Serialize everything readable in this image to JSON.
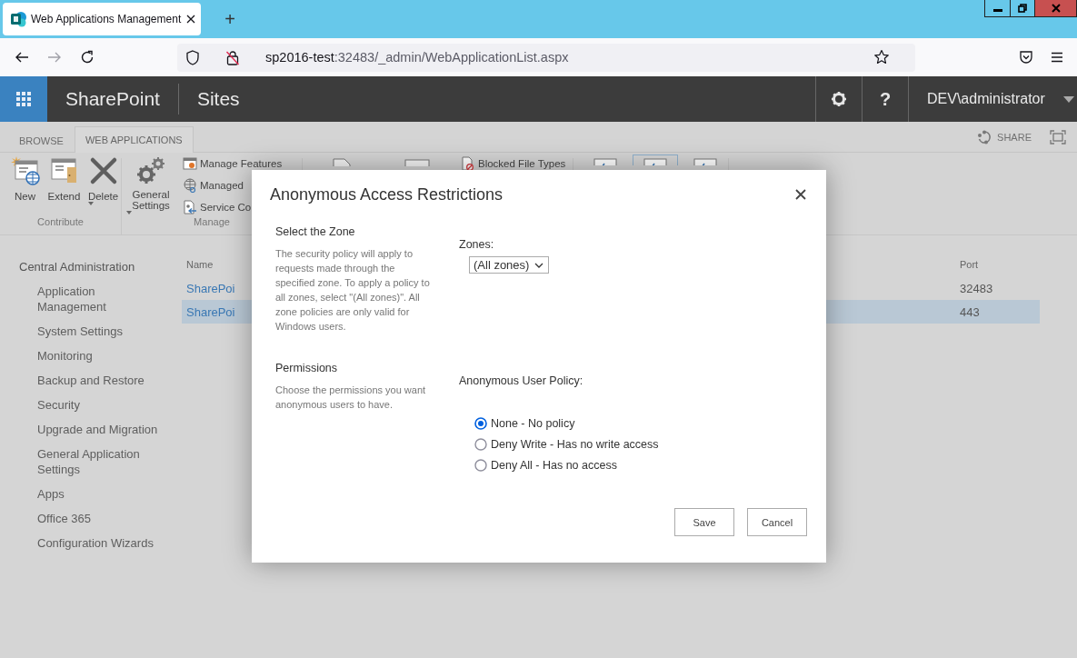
{
  "browser": {
    "tab": {
      "title": "Web Applications Management"
    },
    "new_tab": "+",
    "url": {
      "host": "sp2016-test",
      "path": ":32483/_admin/WebApplicationList.aspx"
    }
  },
  "suite_bar": {
    "brand": "SharePoint",
    "app": "Sites",
    "help": "?",
    "user": "DEV\\administrator"
  },
  "ribbon": {
    "tabs": [
      {
        "label": "BROWSE",
        "selected": false
      },
      {
        "label": "WEB APPLICATIONS",
        "selected": true
      }
    ],
    "share": "SHARE",
    "groups": [
      {
        "label": "Contribute",
        "buttons": [
          {
            "label": "New",
            "menu": false
          },
          {
            "label": "Extend",
            "menu": false
          },
          {
            "label": "Delete",
            "menu": true
          }
        ]
      },
      {
        "label": "Manage",
        "buttons": [
          {
            "label": "General Settings",
            "menu": true
          }
        ],
        "small_buttons": [
          "Manage Features",
          "Managed",
          "Service Co"
        ]
      },
      {
        "small_buttons": [
          "Blocked File Types"
        ]
      },
      {
        "buttons": [
          {
            "selected": false
          },
          {
            "selected": true
          },
          {
            "selected": false
          }
        ]
      }
    ]
  },
  "sidebar": {
    "title": "Central Administration",
    "children": [
      {
        "label": "Application Management"
      },
      {
        "label": "System Settings"
      },
      {
        "label": "Monitoring"
      },
      {
        "label": "Backup and Restore"
      },
      {
        "label": "Security"
      },
      {
        "label": "Upgrade and Migration"
      },
      {
        "label": "General Application Settings"
      },
      {
        "label": "Apps"
      },
      {
        "label": "Office 365"
      },
      {
        "label": "Configuration Wizards"
      }
    ]
  },
  "table": {
    "columns": [
      "Name",
      "Port"
    ],
    "rows": [
      {
        "name": "SharePoi",
        "port": "32483",
        "selected": false
      },
      {
        "name": "SharePoi",
        "port": "443",
        "selected": true
      }
    ]
  },
  "dialog": {
    "title": "Anonymous Access Restrictions",
    "sections": [
      {
        "kind": "select",
        "heading": "Select the Zone",
        "description": "The security policy will apply to requests made through the specified zone. To apply a policy to all zones, select \"(All zones)\". All zone policies are only valid for Windows users.",
        "label": "Zones:",
        "value": "(All zones)"
      },
      {
        "kind": "radios",
        "heading": "Permissions",
        "description": "Choose the permissions you want anonymous users to have.",
        "label": "Anonymous User Policy:",
        "options": [
          {
            "label": "None - No policy",
            "selected": true
          },
          {
            "label": "Deny Write - Has no write access",
            "selected": false
          },
          {
            "label": "Deny All - Has no access",
            "selected": false
          }
        ]
      }
    ],
    "buttons": [
      "Save",
      "Cancel"
    ]
  }
}
